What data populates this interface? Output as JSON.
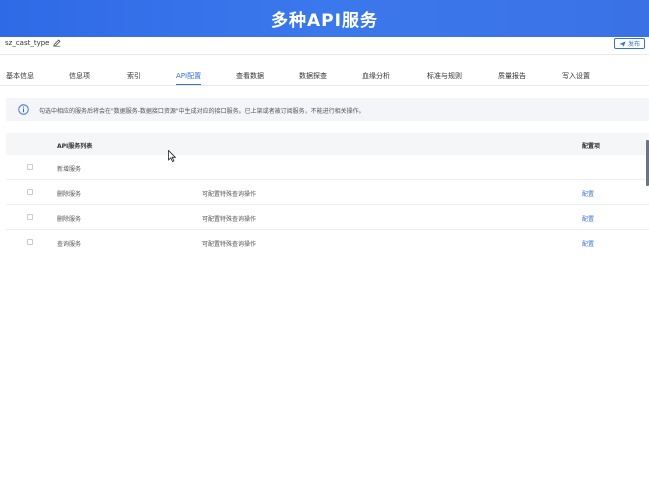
{
  "banner": {
    "title": "多种API服务"
  },
  "header": {
    "breadcrumb": "sz_cast_type",
    "publish_label": "发布"
  },
  "tabs": [
    {
      "label": "基本信息"
    },
    {
      "label": "信息项"
    },
    {
      "label": "索引"
    },
    {
      "label": "API配置",
      "active": true
    },
    {
      "label": "查看数据"
    },
    {
      "label": "数据探查"
    },
    {
      "label": "血缘分析"
    },
    {
      "label": "标准与规则"
    },
    {
      "label": "质量报告"
    },
    {
      "label": "写入设置"
    }
  ],
  "notice": {
    "text": "勾选中相应的服务后将会在\"数据服务-数据接口资源\"中生成对应的接口服务。已上架或者被订阅服务，不能进行相关操作。"
  },
  "table": {
    "headers": {
      "name": "API服务列表",
      "action": "配置项"
    },
    "rows": [
      {
        "name": "新增服务",
        "desc": "",
        "action": ""
      },
      {
        "name": "删除服务",
        "desc": "可配置特殊查询操作",
        "action": "配置"
      },
      {
        "name": "删除服务",
        "desc": "可配置特殊查询操作",
        "action": "配置"
      },
      {
        "name": "查询服务",
        "desc": "可配置特殊查询操作",
        "action": "配置"
      }
    ]
  },
  "colors": {
    "banner": "#3a72e6",
    "accent": "#3a6fd8"
  },
  "icons": {
    "edit": "edit-icon",
    "info": "info-icon",
    "send": "send-icon"
  }
}
